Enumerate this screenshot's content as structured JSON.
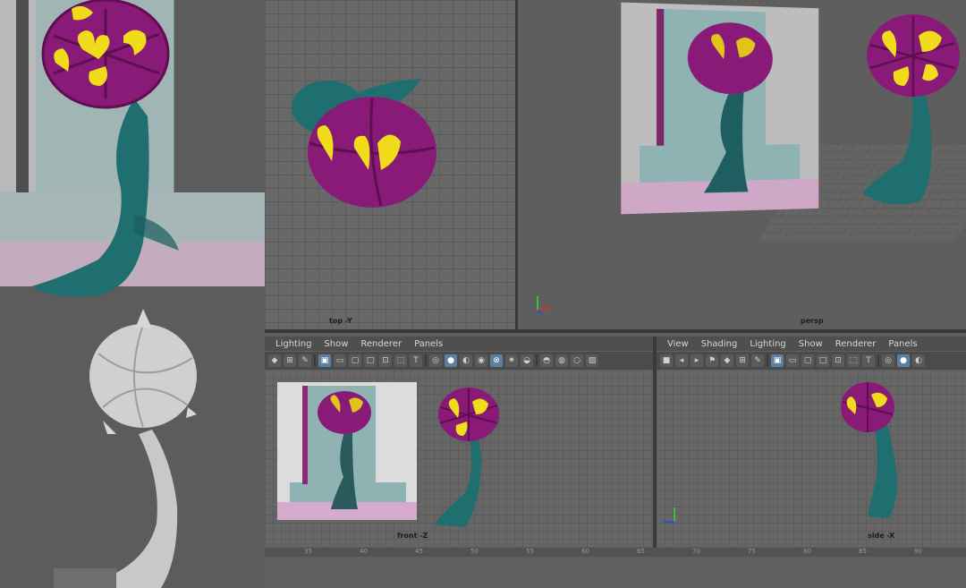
{
  "viewports": {
    "top": {
      "label": "top -Y"
    },
    "persp": {
      "label": "persp"
    },
    "front": {
      "label": "front -Z"
    },
    "side": {
      "label": "side -X"
    }
  },
  "front_panel": {
    "menu": [
      "Lighting",
      "Show",
      "Renderer",
      "Panels"
    ]
  },
  "side_panel": {
    "menu": [
      "View",
      "Shading",
      "Lighting",
      "Show",
      "Renderer",
      "Panels"
    ]
  },
  "timeline": {
    "ticks": [
      "35",
      "40",
      "45",
      "50",
      "55",
      "60",
      "65",
      "70",
      "75",
      "80",
      "85",
      "90"
    ]
  },
  "colors": {
    "flower_purple": "#8a1a78",
    "petal_yellow": "#f0dc1a",
    "stem_teal": "#1f6e70",
    "background": "#5f5f5f"
  }
}
